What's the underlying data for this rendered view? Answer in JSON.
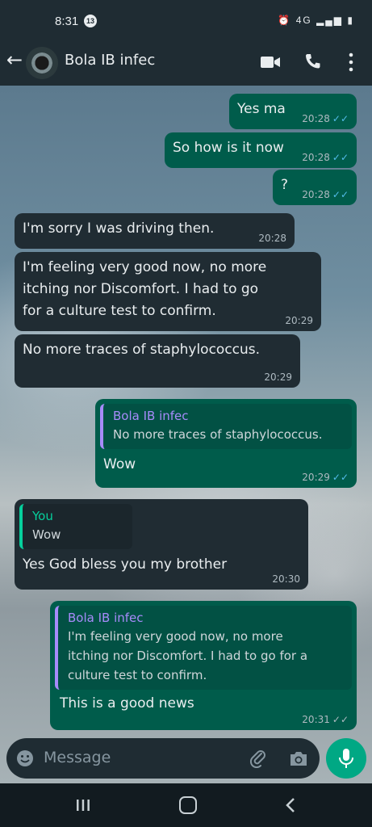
{
  "status_bar": {
    "time": "8:31",
    "badge": "13",
    "network": "4G"
  },
  "header": {
    "back_icon": "back-arrow-icon",
    "contact_name": "Bola IB infec",
    "actions": [
      "video-call-icon",
      "voice-call-icon",
      "more-options-icon"
    ]
  },
  "messages": [
    {
      "dir": "out",
      "text": "Yes ma",
      "time": "20:28",
      "status": "read"
    },
    {
      "dir": "out",
      "text": "So how is it now",
      "time": "20:28",
      "status": "read"
    },
    {
      "dir": "out",
      "text": "?",
      "time": "20:28",
      "status": "read"
    },
    {
      "dir": "in",
      "text": "I'm sorry I was driving then.",
      "time": "20:28"
    },
    {
      "dir": "in",
      "lines": [
        "I'm feeling very good now, no more",
        "itching nor Discomfort. I had to go",
        "for a culture test to confirm."
      ],
      "time": "20:29"
    },
    {
      "dir": "in",
      "text": "No more traces of staphylococcus.",
      "time": "20:29"
    },
    {
      "dir": "out",
      "quote": {
        "name": "Bola IB infec",
        "text": "No more traces of staphylococcus."
      },
      "text": "Wow",
      "time": "20:29",
      "status": "read"
    },
    {
      "dir": "in",
      "quote": {
        "name": "You",
        "text": "Wow"
      },
      "text": "Yes God bless you my brother",
      "time": "20:30"
    },
    {
      "dir": "out",
      "quote": {
        "name": "Bola IB infec",
        "lines": [
          "I'm feeling very good now, no more",
          "itching nor Discomfort. I had to go for a",
          "culture test to confirm."
        ]
      },
      "text": "This is a good news",
      "time": "20:31",
      "status": "delivered"
    }
  ],
  "input": {
    "placeholder": "Message"
  },
  "colors": {
    "outgoing_bubble": "#005c4b",
    "incoming_bubble": "#202c33",
    "accent_green": "#00a884",
    "read_tick": "#53bdeb"
  }
}
